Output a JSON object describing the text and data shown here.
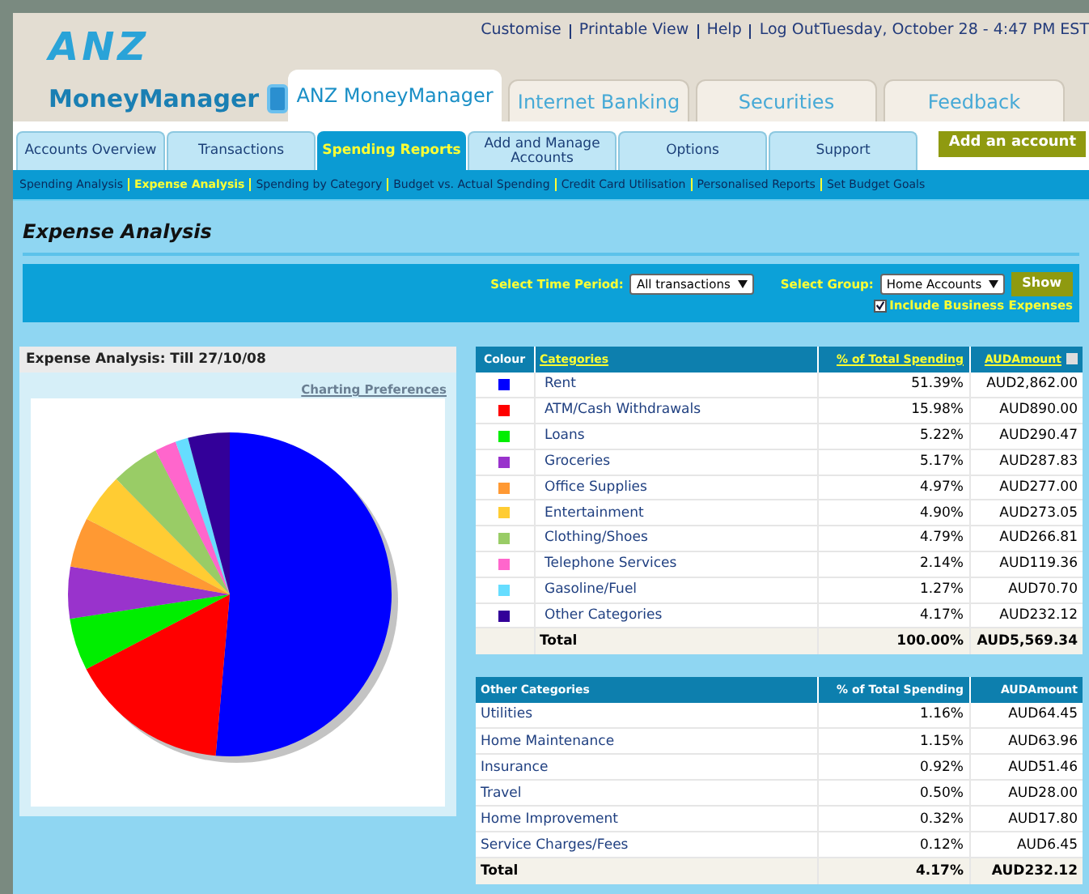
{
  "header": {
    "logo": "ANZ",
    "product": "MoneyManager",
    "top_links": [
      "Customise",
      "Printable View",
      "Help",
      "Log Out"
    ],
    "datetime": "Tuesday, October 28 - 4:47 PM EST"
  },
  "main_tabs": [
    {
      "label": "ANZ MoneyManager",
      "selected": true
    },
    {
      "label": "Internet Banking",
      "selected": false
    },
    {
      "label": "Securities",
      "selected": false
    },
    {
      "label": "Feedback",
      "selected": false
    }
  ],
  "nav_tabs": [
    {
      "label": "Accounts Overview",
      "selected": false
    },
    {
      "label": "Transactions",
      "selected": false
    },
    {
      "label": "Spending Reports",
      "selected": true
    },
    {
      "label": "Add and Manage Accounts",
      "selected": false
    },
    {
      "label": "Options",
      "selected": false
    },
    {
      "label": "Support",
      "selected": false
    }
  ],
  "add_account_button": "Add an account",
  "sub_nav": [
    {
      "label": "Spending Analysis",
      "selected": false
    },
    {
      "label": "Expense Analysis",
      "selected": true
    },
    {
      "label": "Spending by Category",
      "selected": false
    },
    {
      "label": "Budget vs. Actual Spending",
      "selected": false
    },
    {
      "label": "Credit Card Utilisation",
      "selected": false
    },
    {
      "label": "Personalised Reports",
      "selected": false
    },
    {
      "label": "Set Budget Goals",
      "selected": false
    }
  ],
  "page_title": "Expense Analysis",
  "filters": {
    "time_label": "Select Time Period:",
    "time_value": "All transactions",
    "group_label": "Select Group:",
    "group_value": "Home Accounts",
    "show_button": "Show",
    "include_business": {
      "label": "Include Business Expenses",
      "checked": true
    }
  },
  "chart_panel": {
    "title": "Expense Analysis: Till 27/10/08",
    "link": "Charting Preferences"
  },
  "categories_table": {
    "columns": [
      "Colour",
      "Categories",
      "% of Total Spending",
      "AUDAmount"
    ],
    "rows": [
      {
        "color": "#0000ff",
        "category": "Rent",
        "percent": "51.39%",
        "amount": "AUD2,862.00"
      },
      {
        "color": "#ff0000",
        "category": "ATM/Cash Withdrawals",
        "percent": "15.98%",
        "amount": "AUD890.00"
      },
      {
        "color": "#00ee00",
        "category": "Loans",
        "percent": "5.22%",
        "amount": "AUD290.47"
      },
      {
        "color": "#9933cc",
        "category": "Groceries",
        "percent": "5.17%",
        "amount": "AUD287.83"
      },
      {
        "color": "#ff9933",
        "category": "Office Supplies",
        "percent": "4.97%",
        "amount": "AUD277.00"
      },
      {
        "color": "#ffcc33",
        "category": "Entertainment",
        "percent": "4.90%",
        "amount": "AUD273.05"
      },
      {
        "color": "#99cc66",
        "category": "Clothing/Shoes",
        "percent": "4.79%",
        "amount": "AUD266.81"
      },
      {
        "color": "#ff66cc",
        "category": "Telephone Services",
        "percent": "2.14%",
        "amount": "AUD119.36"
      },
      {
        "color": "#66ddff",
        "category": "Gasoline/Fuel",
        "percent": "1.27%",
        "amount": "AUD70.70"
      },
      {
        "color": "#330099",
        "category": "Other Categories",
        "percent": "4.17%",
        "amount": "AUD232.12"
      }
    ],
    "total": {
      "label": "Total",
      "percent": "100.00%",
      "amount": "AUD5,569.34"
    }
  },
  "other_table": {
    "columns": [
      "Other Categories",
      "% of Total Spending",
      "AUDAmount"
    ],
    "rows": [
      {
        "category": "Utilities",
        "percent": "1.16%",
        "amount": "AUD64.45"
      },
      {
        "category": "Home Maintenance",
        "percent": "1.15%",
        "amount": "AUD63.96"
      },
      {
        "category": "Insurance",
        "percent": "0.92%",
        "amount": "AUD51.46"
      },
      {
        "category": "Travel",
        "percent": "0.50%",
        "amount": "AUD28.00"
      },
      {
        "category": "Home Improvement",
        "percent": "0.32%",
        "amount": "AUD17.80"
      },
      {
        "category": "Service Charges/Fees",
        "percent": "0.12%",
        "amount": "AUD6.45"
      }
    ],
    "total": {
      "label": "Total",
      "percent": "4.17%",
      "amount": "AUD232.12"
    }
  }
}
